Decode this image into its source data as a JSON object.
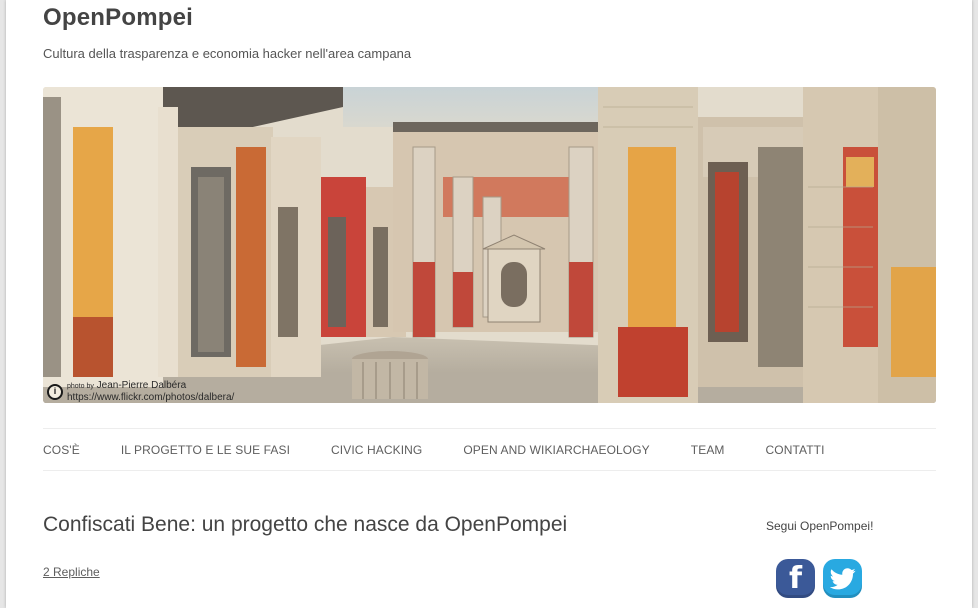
{
  "site": {
    "title": "OpenPompei",
    "description": "Cultura della trasparenza e economia hacker nell'area campana"
  },
  "banner": {
    "credit_prefix": "photo by",
    "credit_name": "Jean-Pierre Dalbéra",
    "credit_url": "https://www.flickr.com/photos/dalbera/",
    "icon": "cc-attribution-icon"
  },
  "nav": {
    "items": [
      "COS'È",
      "IL PROGETTO E LE SUE FASI",
      "CIVIC HACKING",
      "OPEN AND WIKIARCHAEOLOGY",
      "TEAM",
      "CONTATTI"
    ]
  },
  "post": {
    "title": "Confiscati Bene: un progetto che nasce da OpenPompei",
    "replies": "2 Repliche"
  },
  "sidebar": {
    "widget_title": "Segui OpenPompei!",
    "social": [
      {
        "name": "facebook-icon",
        "glyph": "f",
        "color": "#3b5998"
      },
      {
        "name": "twitter-icon",
        "glyph": "bird",
        "color": "#29a9e1"
      }
    ]
  }
}
